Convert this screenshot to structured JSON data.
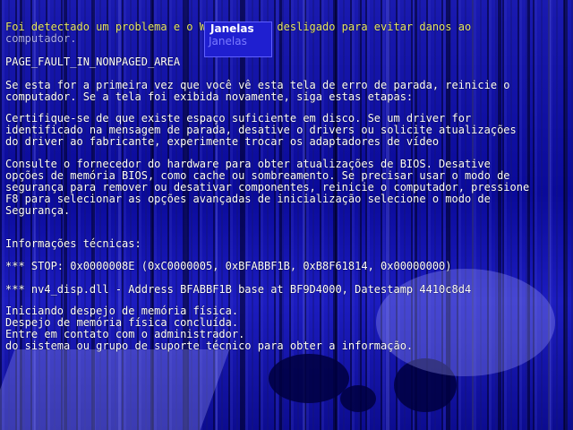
{
  "screen": {
    "lines": [
      "Foi detectado um problema e o Windows foi desligado para evitar danos ao",
      "computador.",
      "PAGE_FAULT_IN_NONPAGED_AREA",
      "Se esta for a primeira vez que você vê esta tela de erro de parada, reinicie o",
      "computador. Se a tela foi exibida novamente, siga estas etapas:",
      "Certifique-se de que existe espaço suficiente em disco. Se um driver for",
      "identificado na mensagem de parada, desative o drivers ou solicite atualizações",
      "do driver ao fabricante, experimente trocar os adaptadores de vídeo",
      "Consulte o fornecedor do hardware para obter atualizações de BIOS. Desative",
      "opções de memória BIOS, como cache ou sombreamento. Se precisar usar o modo de",
      "segurança para remover ou desativar componentes, reinicie o computador, pressione",
      "F8 para selecionar as opções avançadas de inicialização selecione o modo de",
      "Segurança.",
      "Informações técnicas:",
      "*** STOP: 0x0000008E (0xC0000005, 0xBFABBF1B, 0xB8F61814, 0x00000000)",
      "*** nv4_disp.dll - Address BFABBF1B base at BF9D4000, Datestamp 4410c8d4",
      "Iniciando despejo de memória física.",
      "Despejo de memória física concluída.",
      "Entre em contato com o administrador.",
      "do sistema ou grupo de suporte técnico para obter a informação."
    ]
  },
  "popup": {
    "title": "Janelas",
    "subtitle": "Janelas"
  }
}
